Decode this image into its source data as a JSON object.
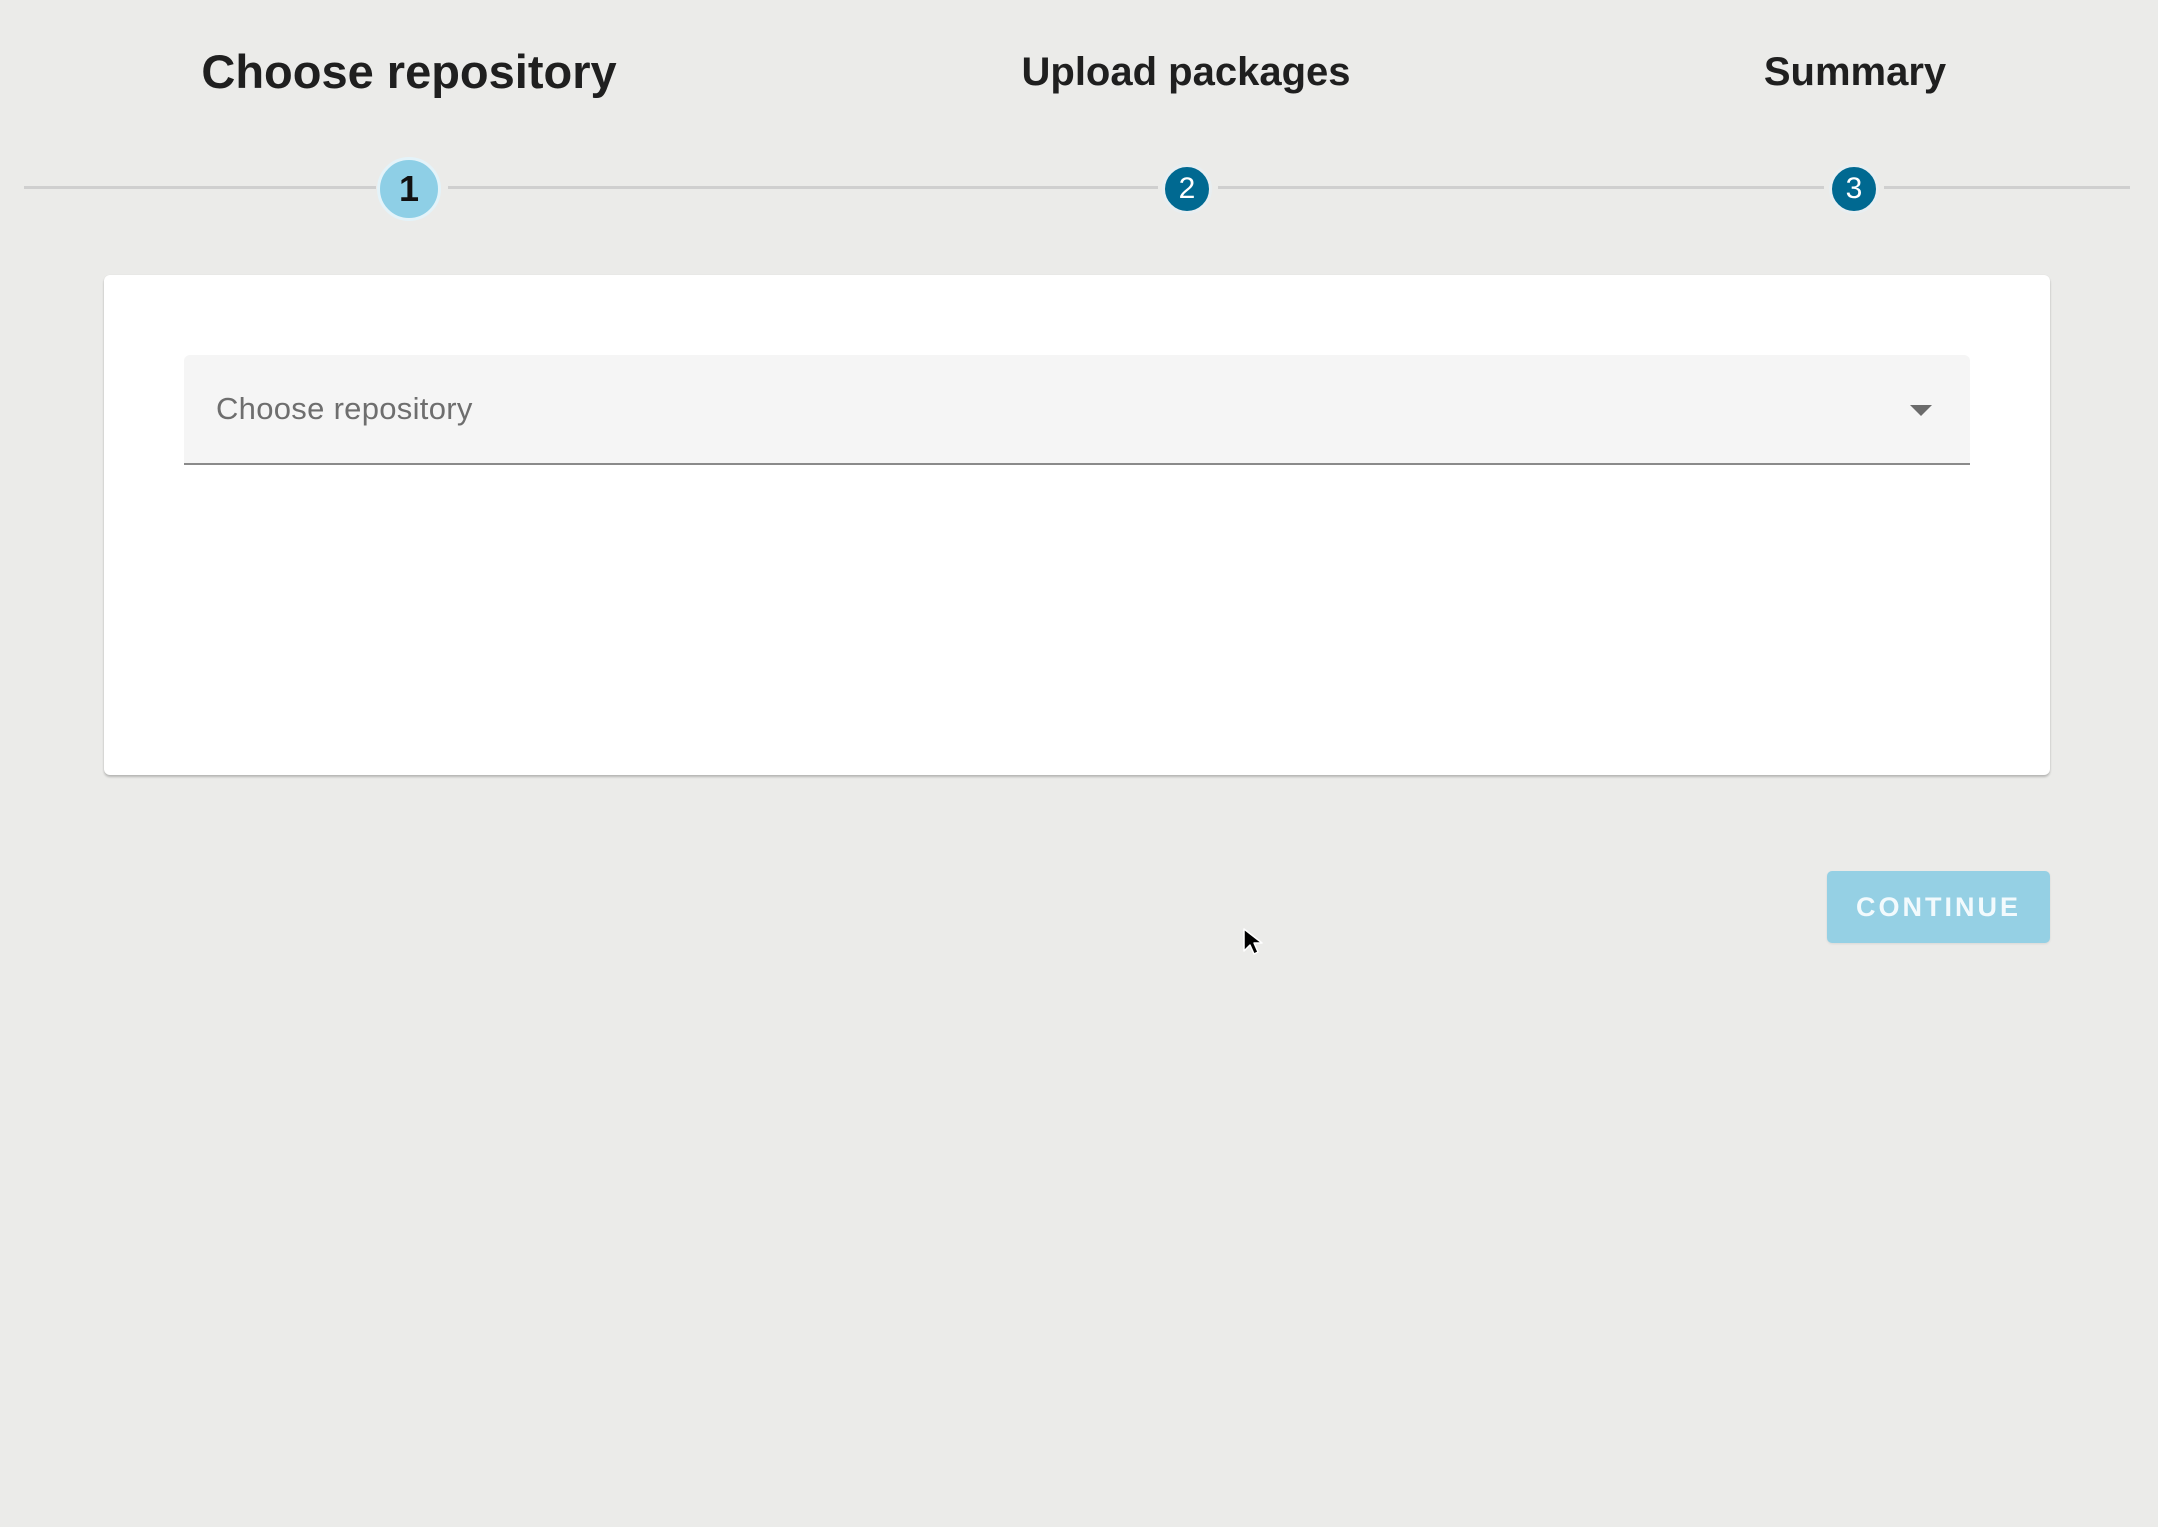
{
  "stepper": {
    "steps": [
      {
        "title": "Choose repository",
        "number": "1",
        "state": "active"
      },
      {
        "title": "Upload packages",
        "number": "2",
        "state": "inactive"
      },
      {
        "title": "Summary",
        "number": "3",
        "state": "inactive"
      }
    ]
  },
  "form": {
    "repository_select": {
      "placeholder": "Choose repository",
      "value": ""
    }
  },
  "actions": {
    "continue_label": "CONTINUE",
    "continue_enabled": false
  },
  "icons": {
    "dropdown": "chevron-down-icon",
    "cursor": "mouse-pointer-icon"
  },
  "colors": {
    "background": "#ebebe9",
    "active_step": "#8ecfe6",
    "inactive_step": "#006991",
    "continue_button": "#95d0e4"
  }
}
